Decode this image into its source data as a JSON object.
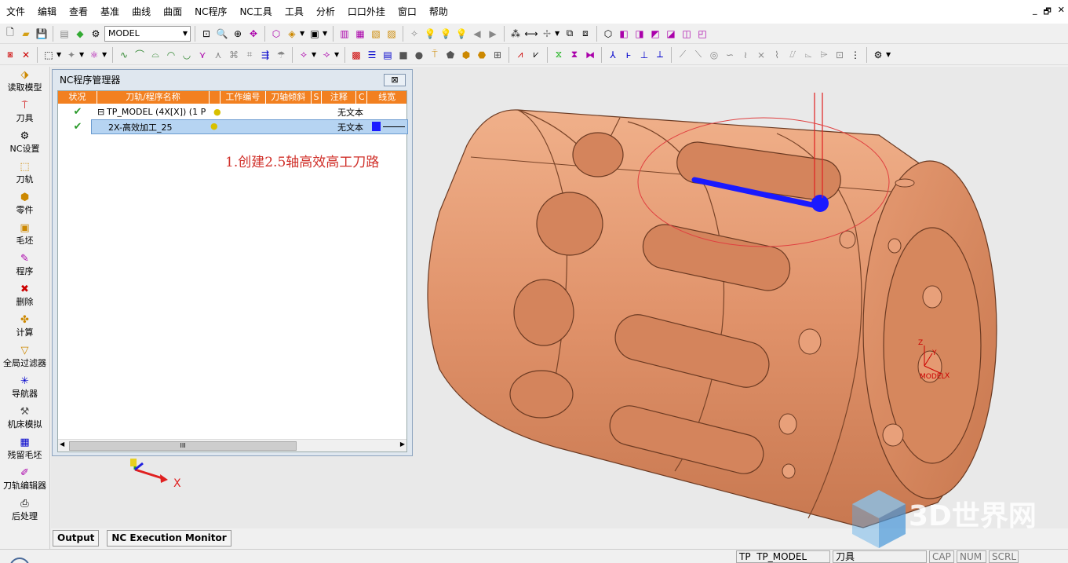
{
  "menu": [
    "文件",
    "编辑",
    "查看",
    "基准",
    "曲线",
    "曲面",
    "NC程序",
    "NC工具",
    "工具",
    "分析",
    "口口外挂",
    "窗口",
    "帮助"
  ],
  "window_controls": [
    "_",
    "🗗",
    "✕"
  ],
  "toolbar": {
    "model_select": "MODEL"
  },
  "sidebar": [
    "读取模型",
    "刀具",
    "NC设置",
    "刀轨",
    "零件",
    "毛坯",
    "程序",
    "删除",
    "计算",
    "全局过滤器",
    "导航器",
    "机床模拟",
    "残留毛坯",
    "刀轨编辑器",
    "后处理"
  ],
  "nc_manager": {
    "title": "NC程序管理器",
    "close_label": "⊠",
    "columns": [
      "状况",
      "刀轨/程序名称",
      "",
      "工作编号",
      "刀轴倾斜",
      "S",
      "注释",
      "C",
      "线宽"
    ],
    "rows": [
      {
        "expander": "⊟",
        "name": "TP_MODEL (4X[X]) (1 P",
        "note": "无文本"
      },
      {
        "expander": "",
        "name": "2X-高效加工_25",
        "note": "无文本"
      }
    ],
    "scroll_grip": "III"
  },
  "annotation": "1.创建2.5轴高效高工刀路",
  "axes": {
    "x": "X",
    "y": "Y",
    "z": "Z",
    "model": "MODEL"
  },
  "tabs": [
    "Output",
    "NC Execution Monitor"
  ],
  "status": {
    "tp": "TP",
    "model": "TP_MODEL",
    "tool": "刀具",
    "caps": "CAP",
    "num": "NUM",
    "scrl": "SCRL"
  },
  "watermark": "3D世界网",
  "colors": {
    "part": "#e0926a",
    "accent": "#f28020",
    "toolpath": "#1a1aff",
    "circle": "#e04040"
  }
}
